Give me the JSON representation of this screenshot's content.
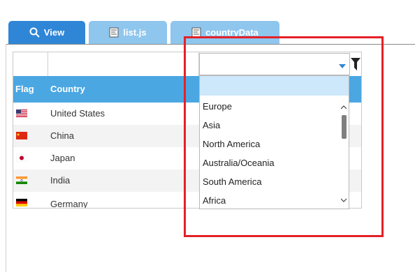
{
  "tabs": [
    {
      "label": "View",
      "icon": "search-icon"
    },
    {
      "label": "list.js",
      "icon": "document-icon"
    },
    {
      "label": "countryData",
      "icon": "document-icon"
    }
  ],
  "columns": [
    "Flag",
    "Country"
  ],
  "rows": [
    {
      "country": "United States",
      "flag": "united-states-flag-icon"
    },
    {
      "country": "China",
      "flag": "china-flag-icon"
    },
    {
      "country": "Japan",
      "flag": "japan-flag-icon"
    },
    {
      "country": "India",
      "flag": "india-flag-icon"
    },
    {
      "country": "Germany",
      "flag": "germany-flag-icon"
    }
  ],
  "dropdown": {
    "selected": "",
    "options": [
      "Europe",
      "Asia",
      "North America",
      "Australia/Oceania",
      "South America",
      "Africa"
    ]
  },
  "colors": {
    "tab_active": "#2f86d6",
    "tab_inactive": "#8fc6ee",
    "header": "#4ba7e2",
    "selected": "#cde7fb",
    "highlight": "#e42127"
  }
}
